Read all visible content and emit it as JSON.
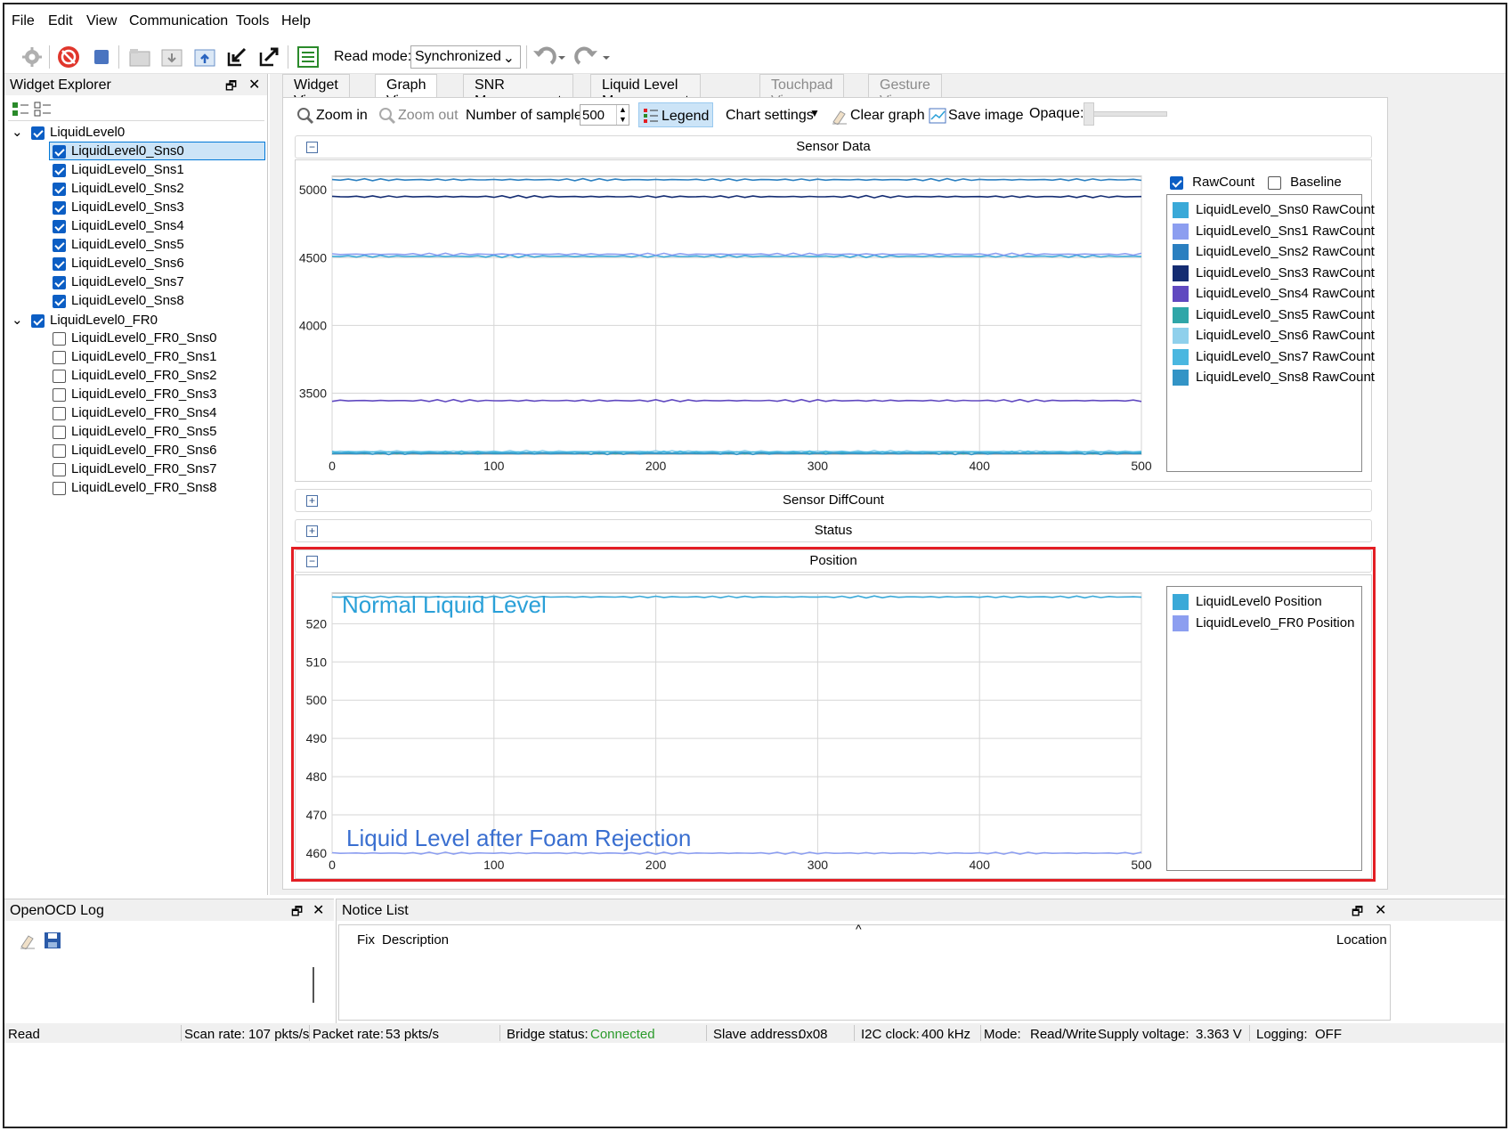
{
  "menu": [
    "File",
    "Edit",
    "View",
    "Communication",
    "Tools",
    "Help"
  ],
  "toolbar": {
    "read_mode_label": "Read mode:",
    "read_mode_value": "Synchronized"
  },
  "explorer": {
    "title": "Widget Explorer",
    "groups": [
      {
        "label": "LiquidLevel0",
        "checked": true,
        "items": [
          {
            "label": "LiquidLevel0_Sns0",
            "checked": true
          },
          {
            "label": "LiquidLevel0_Sns1",
            "checked": true
          },
          {
            "label": "LiquidLevel0_Sns2",
            "checked": true
          },
          {
            "label": "LiquidLevel0_Sns3",
            "checked": true
          },
          {
            "label": "LiquidLevel0_Sns4",
            "checked": true
          },
          {
            "label": "LiquidLevel0_Sns5",
            "checked": true
          },
          {
            "label": "LiquidLevel0_Sns6",
            "checked": true
          },
          {
            "label": "LiquidLevel0_Sns7",
            "checked": true
          },
          {
            "label": "LiquidLevel0_Sns8",
            "checked": true
          }
        ]
      },
      {
        "label": "LiquidLevel0_FR0",
        "checked": true,
        "items": [
          {
            "label": "LiquidLevel0_FR0_Sns0",
            "checked": false
          },
          {
            "label": "LiquidLevel0_FR0_Sns1",
            "checked": false
          },
          {
            "label": "LiquidLevel0_FR0_Sns2",
            "checked": false
          },
          {
            "label": "LiquidLevel0_FR0_Sns3",
            "checked": false
          },
          {
            "label": "LiquidLevel0_FR0_Sns4",
            "checked": false
          },
          {
            "label": "LiquidLevel0_FR0_Sns5",
            "checked": false
          },
          {
            "label": "LiquidLevel0_FR0_Sns6",
            "checked": false
          },
          {
            "label": "LiquidLevel0_FR0_Sns7",
            "checked": false
          },
          {
            "label": "LiquidLevel0_FR0_Sns8",
            "checked": false
          }
        ]
      }
    ]
  },
  "tabs": [
    {
      "label": "Widget View",
      "state": "normal"
    },
    {
      "label": "Graph View",
      "state": "active"
    },
    {
      "label": "SNR Measurement",
      "state": "normal"
    },
    {
      "label": "Liquid Level Measurement",
      "state": "normal"
    },
    {
      "label": "Touchpad View",
      "state": "disabled"
    },
    {
      "label": "Gesture View",
      "state": "disabled"
    }
  ],
  "graph_toolbar": {
    "zoom_in": "Zoom in",
    "zoom_out": "Zoom out",
    "samples_label": "Number of samples:",
    "samples_value": "500",
    "legend": "Legend",
    "chart_settings": "Chart settings",
    "clear_graph": "Clear graph",
    "save_image": "Save image",
    "opaque": "Opaque:"
  },
  "sections": {
    "sensor_data": "Sensor Data",
    "diffcount": "Sensor DiffCount",
    "status": "Status",
    "position": "Position"
  },
  "sensor_legend": {
    "rawcount": "RawCount",
    "baseline": "Baseline",
    "rawcount_checked": true,
    "baseline_checked": false
  },
  "position_annotations": {
    "top": "Normal Liquid Level",
    "bottom": "Liquid Level after Foam Rejection"
  },
  "chart_data": [
    {
      "type": "line",
      "title": "Sensor Data",
      "xlim": [
        0,
        500
      ],
      "ylim": [
        3050,
        5100
      ],
      "xticks": [
        0,
        100,
        200,
        300,
        400,
        500
      ],
      "yticks": [
        3500,
        4000,
        4500,
        5000
      ],
      "grid": true,
      "legend_position": "right",
      "series": [
        {
          "name": "LiquidLevel0_Sns0 RawCount",
          "color": "#3aa9d8",
          "level": 4510
        },
        {
          "name": "LiquidLevel0_Sns1 RawCount",
          "color": "#8c9ef0",
          "level": 4525
        },
        {
          "name": "LiquidLevel0_Sns2 RawCount",
          "color": "#2a7fc0",
          "level": 5075
        },
        {
          "name": "LiquidLevel0_Sns3 RawCount",
          "color": "#142c72",
          "level": 4950
        },
        {
          "name": "LiquidLevel0_Sns4 RawCount",
          "color": "#6049c0",
          "level": 3445
        },
        {
          "name": "LiquidLevel0_Sns5 RawCount",
          "color": "#2fa6a8",
          "level": 3060
        },
        {
          "name": "LiquidLevel0_Sns6 RawCount",
          "color": "#8fd0ec",
          "level": 3070
        },
        {
          "name": "LiquidLevel0_Sns7 RawCount",
          "color": "#4ab7e0",
          "level": 3065
        },
        {
          "name": "LiquidLevel0_Sns8 RawCount",
          "color": "#3394c6",
          "level": 3055
        }
      ]
    },
    {
      "type": "line",
      "title": "Position",
      "xlim": [
        0,
        500
      ],
      "ylim": [
        460,
        528
      ],
      "xticks": [
        0,
        100,
        200,
        300,
        400,
        500
      ],
      "yticks": [
        460,
        470,
        480,
        490,
        500,
        510,
        520
      ],
      "grid": true,
      "legend_position": "right",
      "series": [
        {
          "name": "LiquidLevel0 Position",
          "color": "#3aa9d8",
          "level": 527
        },
        {
          "name": "LiquidLevel0_FR0 Position",
          "color": "#8c9ef0",
          "level": 460
        }
      ]
    }
  ],
  "bottom": {
    "log_title": "OpenOCD Log",
    "notice_title": "Notice List",
    "col_fix": "Fix",
    "col_desc": "Description",
    "col_loc": "Location"
  },
  "status": {
    "read": "Read",
    "scan_rate_label": "Scan rate:",
    "scan_rate": "107 pkts/s",
    "packet_rate_label": "Packet rate:",
    "packet_rate": "53 pkts/s",
    "bridge_label": "Bridge status:",
    "bridge": "Connected",
    "slave_label": "Slave address:",
    "slave": "0x08",
    "i2c_label": "I2C clock:",
    "i2c": "400 kHz",
    "mode_label": "Mode:",
    "mode": "Read/Write",
    "supply_label": "Supply voltage:",
    "supply": "3.363 V",
    "logging_label": "Logging:",
    "logging": "OFF"
  },
  "colors": {
    "accent": "#0c5ec4",
    "highlight": "#e31e24",
    "connected": "#2a9a2a",
    "annotation_top": "#2aa0d8",
    "annotation_bottom": "#3a6fd0"
  }
}
